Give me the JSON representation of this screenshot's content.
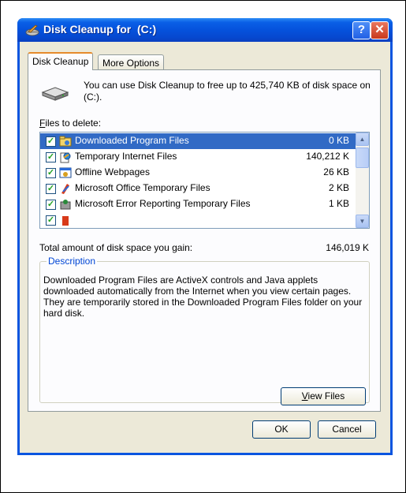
{
  "window": {
    "title": "Disk Cleanup for  (C:)",
    "help_label": "?",
    "close_label": "✕"
  },
  "tabs": [
    {
      "label": "Disk Cleanup"
    },
    {
      "label": "More Options"
    }
  ],
  "intro": {
    "text": "You can use Disk Cleanup to free up to 425,740 KB of disk space on  (C:)."
  },
  "files_label": {
    "accel": "F",
    "rest": "iles to delete:"
  },
  "files": [
    {
      "name": "Downloaded Program Files",
      "size": "0 KB",
      "checked": true,
      "selected": true,
      "icon": "folder-icon"
    },
    {
      "name": "Temporary Internet Files",
      "size": "140,212 K",
      "checked": true,
      "selected": false,
      "icon": "internet-files-icon"
    },
    {
      "name": "Offline Webpages",
      "size": "26 KB",
      "checked": true,
      "selected": false,
      "icon": "offline-webpages-icon"
    },
    {
      "name": "Microsoft Office Temporary Files",
      "size": "2 KB",
      "checked": true,
      "selected": false,
      "icon": "office-icon"
    },
    {
      "name": "Microsoft Error Reporting Temporary Files",
      "size": "1 KB",
      "checked": true,
      "selected": false,
      "icon": "error-reporting-icon"
    }
  ],
  "total": {
    "label": "Total amount of disk space you gain:",
    "value": "146,019 K"
  },
  "description": {
    "title": "Description",
    "text": "Downloaded Program Files are ActiveX controls and Java applets downloaded automatically from the Internet when you view certain pages. They are temporarily stored in the Downloaded Program Files folder on your hard disk."
  },
  "buttons": {
    "view_accel": "V",
    "view_rest": "iew Files",
    "ok": "OK",
    "cancel": "Cancel"
  },
  "colors": {
    "titlebar": "#0552dc",
    "selection": "#316ac5",
    "face": "#ece9d8",
    "group_title": "#0046d5"
  }
}
